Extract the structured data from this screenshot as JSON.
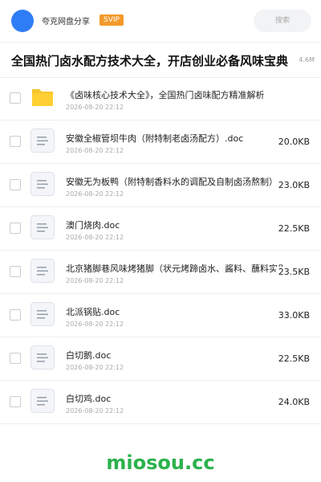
{
  "header": {
    "brand": "夸克网盘分享",
    "badge": "SVIP",
    "search_placeholder": "搜索"
  },
  "share": {
    "title": "全国热门卤水配方技术大全，开店创业必备风味宝典",
    "total_size": "4.6M"
  },
  "files": [
    {
      "type": "folder",
      "name": "《卤味核心技术大全》，全国热门卤味配方精准解析",
      "date": "2026-08-20 22:12",
      "size": ""
    },
    {
      "type": "doc",
      "name": "安徽全椒管坝牛肉（附特制老卤汤配方）.doc",
      "date": "2026-08-20 22:12",
      "size": "20.0KB"
    },
    {
      "type": "doc",
      "name": "安徽无为板鸭（附特制香料水的调配及自制卤汤熬制）.doc",
      "date": "2026-08-20 22:12",
      "size": "23.0KB"
    },
    {
      "type": "doc",
      "name": "澳门烧肉.doc",
      "date": "2026-08-20 22:12",
      "size": "22.5KB"
    },
    {
      "type": "doc",
      "name": "北京猪脚巷风味烤猪脚（状元烤蹄卤水、酱料、蘸料实用.doc",
      "date": "2026-08-20 22:12",
      "size": "23.5KB"
    },
    {
      "type": "doc",
      "name": "北派锅贴.doc",
      "date": "2026-08-20 22:12",
      "size": "33.0KB"
    },
    {
      "type": "doc",
      "name": "白切鹅.doc",
      "date": "2026-08-20 22:12",
      "size": "22.5KB"
    },
    {
      "type": "doc",
      "name": "白切鸡.doc",
      "date": "2026-08-20 22:12",
      "size": "24.0KB"
    }
  ],
  "watermark": "miosou.cc",
  "colors": {
    "accent": "#2f7df6",
    "badge": "#f39a2a",
    "folder": "#f7c52b",
    "watermark": "#2bb24c"
  }
}
